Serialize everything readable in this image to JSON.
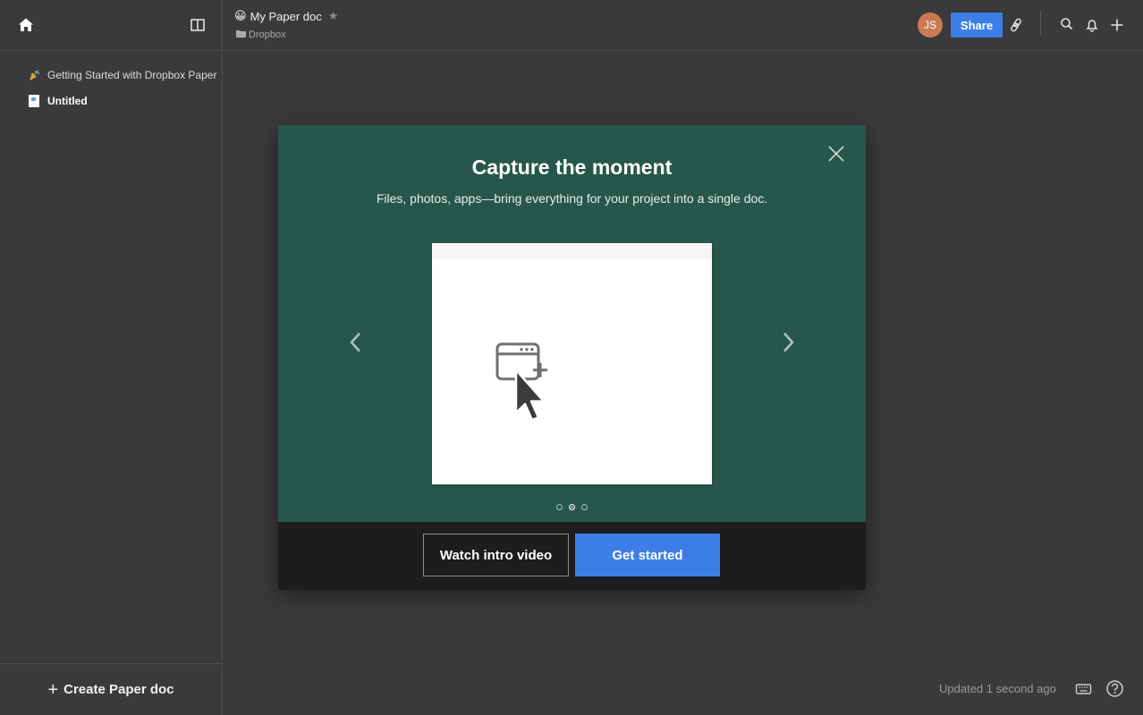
{
  "sidebar": {
    "items": [
      {
        "label": "Getting Started with Dropbox Paper",
        "icon": "party-popper-icon"
      },
      {
        "label": "Untitled",
        "icon": "document-icon"
      }
    ],
    "create_label": "Create Paper doc"
  },
  "header": {
    "title": "My Paper doc",
    "title_emoji": "😀",
    "breadcrumb": "Dropbox",
    "avatar_initials": "JS",
    "share_label": "Share"
  },
  "modal": {
    "title": "Capture the moment",
    "subtitle": "Files, photos, apps—bring everything for your project into a single doc.",
    "watch_label": "Watch intro video",
    "start_label": "Get started",
    "page_count": 3,
    "active_page": 2
  },
  "footer": {
    "updated": "Updated 1 second ago"
  },
  "colors": {
    "accent": "#3d7ee6",
    "modal_green": "#27574a",
    "avatar": "#c97a52"
  }
}
